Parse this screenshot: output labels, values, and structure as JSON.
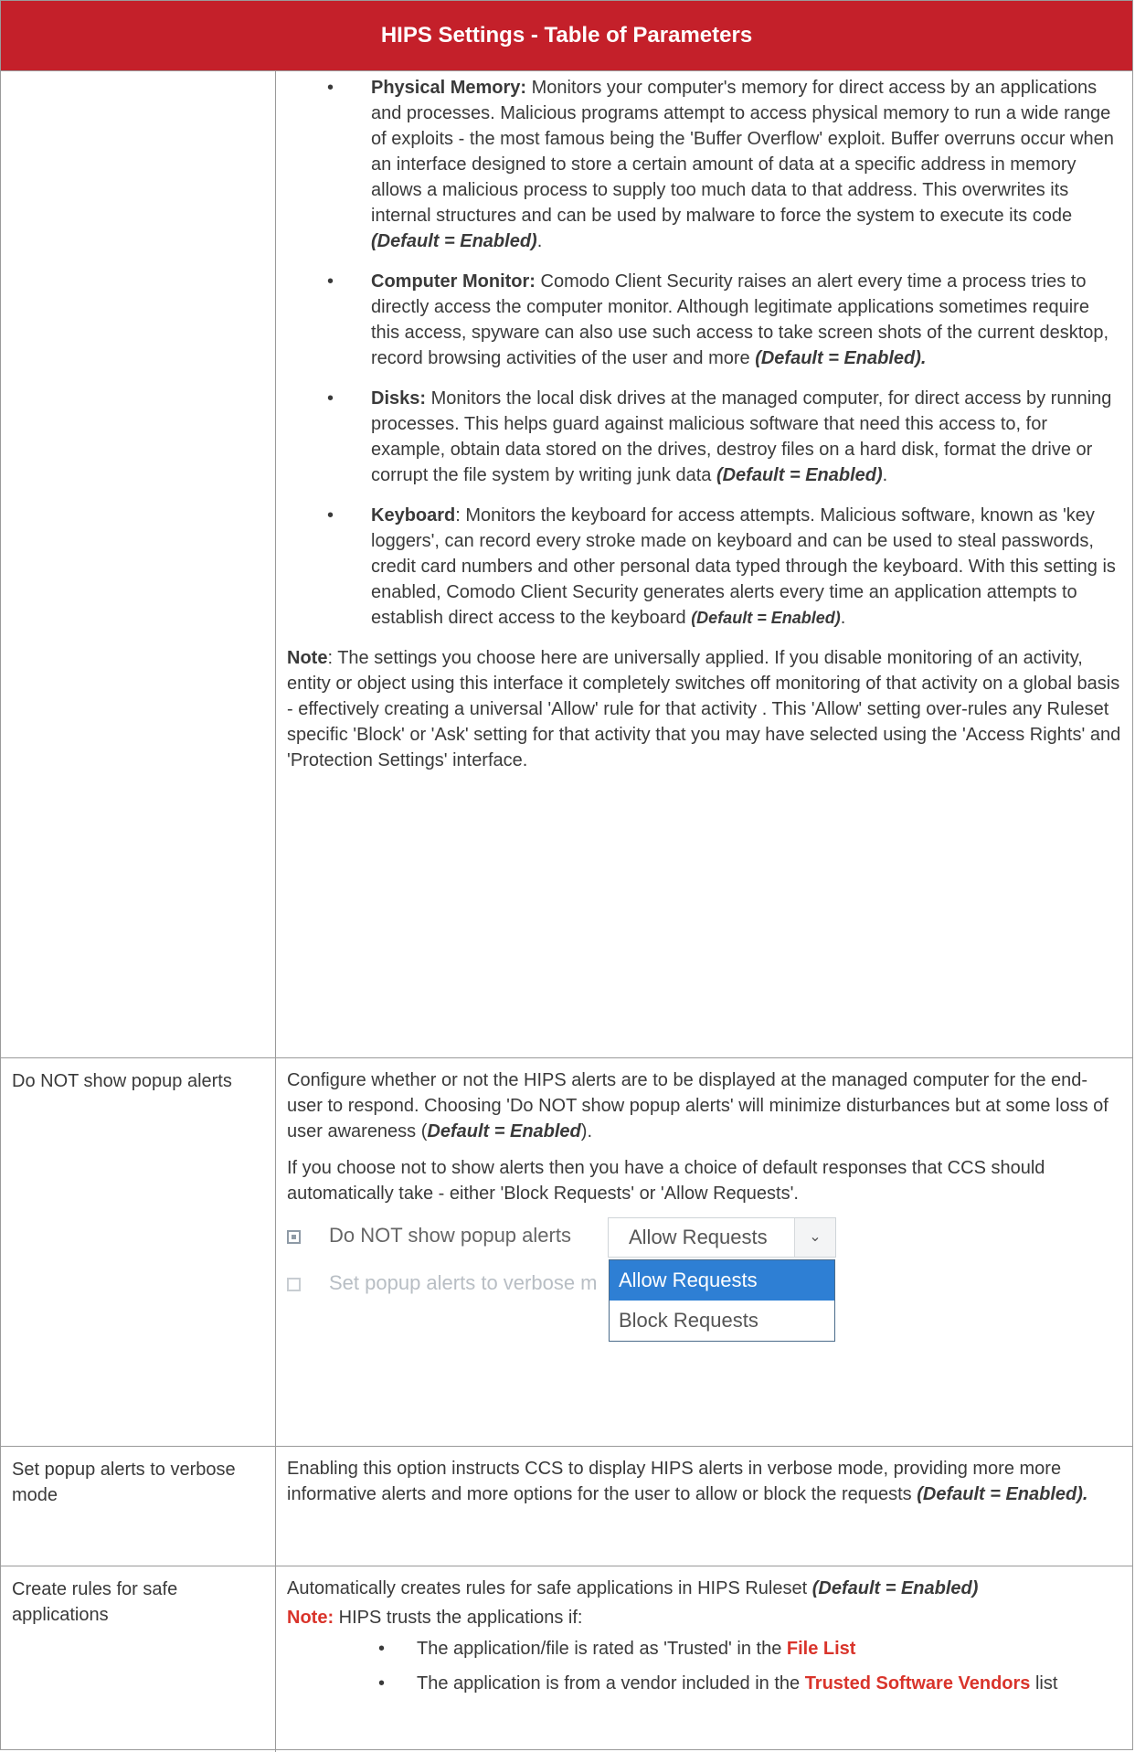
{
  "header": {
    "title": "HIPS Settings - Table of Parameters"
  },
  "row1": {
    "bullets": [
      {
        "term": "Physical Memory:",
        "text": " Monitors your computer's memory for direct access by an applications and processes. Malicious programs attempt to access physical memory to run a wide range of exploits - the most famous being the 'Buffer Overflow' exploit. Buffer overruns occur when an interface designed to store a certain amount of data at a specific address in memory allows a malicious process to supply too much data to that address. This overwrites its internal structures and can be used by malware to force the system to execute its code ",
        "default": "(Default = Enabled)",
        "tail": "."
      },
      {
        "term": "Computer Monitor:",
        "text": " Comodo Client Security raises an alert every time a process tries to directly access the computer monitor. Although legitimate applications sometimes require this access, spyware can also use such access to take screen shots of the current desktop, record browsing activities of the user and more ",
        "default": "(Default = Enabled).",
        "tail": ""
      },
      {
        "term": "Disks:",
        "text": " Monitors the local disk drives at the managed computer, for direct access by running processes. This helps guard against malicious software that need this access to, for example, obtain data stored on the drives, destroy files on a hard disk, format the drive or corrupt the file system by writing junk data ",
        "default": "(Default = Enabled)",
        "tail": "."
      },
      {
        "term": "Keyboard",
        "text": ": Monitors the keyboard for access attempts. Malicious software, known as 'key loggers', can record every stroke made on keyboard and can be used to steal passwords, credit card numbers and other personal data typed through the keyboard. With this setting is enabled, Comodo Client Security generates alerts every time an application attempts to establish direct access to the keyboard ",
        "default": "(Default = Enabled)",
        "tail": "."
      }
    ],
    "note_label": "Note",
    "note_text": ": The settings you choose here are universally applied. If you disable monitoring of an activity, entity or object using this interface it completely switches off monitoring of that activity on a global basis - effectively creating a universal 'Allow' rule for that activity . This 'Allow' setting over-rules any Ruleset specific 'Block' or 'Ask' setting for that activity that you may have selected using the 'Access Rights' and 'Protection Settings' interface."
  },
  "row2": {
    "label": "Do NOT show popup alerts",
    "p1": "Configure whether or not the HIPS alerts are to be displayed at the managed computer for the end-user to respond. Choosing 'Do NOT show popup alerts' will minimize disturbances but at some loss of user awareness (",
    "p1_default": "Default = Enabled",
    "p1_tail": ").",
    "p2": "If you choose not to show alerts then you have a choice of default responses that CCS should automatically take - either 'Block Requests' or 'Allow Requests'.",
    "widget": {
      "checkbox_label": "Do NOT show popup alerts",
      "faded_label": "Set popup alerts to verbose m",
      "selected": "Allow Requests",
      "options": [
        "Allow Requests",
        "Block Requests"
      ]
    }
  },
  "row3": {
    "label": "Set popup alerts to verbose mode",
    "text": "Enabling this option instructs CCS to display HIPS alerts in verbose mode, providing more more informative alerts and more options for the user to allow or block the requests ",
    "default": "(Default = Enabled)."
  },
  "row4": {
    "label": "Create rules for safe applications",
    "text": "Automatically creates rules for safe applications in HIPS Ruleset ",
    "default": "(Default = Enabled)",
    "note_label": "Note:",
    "note_text": " HIPS trusts the applications if:",
    "sub": [
      {
        "pre": "The application/file is rated as 'Trusted' in the ",
        "link": "File List",
        "post": ""
      },
      {
        "pre": "The application is from a vendor included in the ",
        "link": "Trusted Software Vendors",
        "post": " list"
      }
    ]
  }
}
